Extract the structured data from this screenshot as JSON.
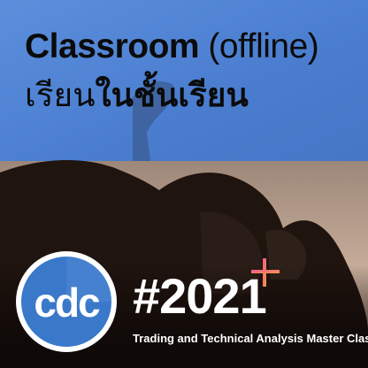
{
  "headline": {
    "english_bold": "Classroom",
    "english_light": "(offline)",
    "thai_light": "เรียน",
    "thai_bold": "ในชั้นเรียน"
  },
  "logo": {
    "text": "cdc"
  },
  "promo": {
    "year": "#2021",
    "subtitle": "Trading and Technical Analysis Master Class"
  },
  "colors": {
    "sky_blue": "#4d7fd0",
    "logo_blue": "#3a78c9",
    "plus_pink": "#f05590",
    "plus_orange": "#f59a45"
  }
}
